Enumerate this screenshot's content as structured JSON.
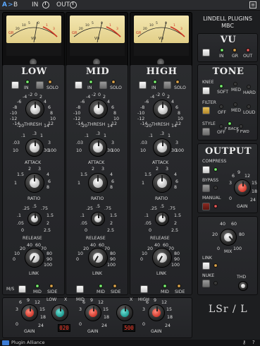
{
  "topbar": {
    "a": "A",
    "arrow": ">",
    "b": "B",
    "in": "IN",
    "out": "OUT",
    "help": "?"
  },
  "brand": {
    "line1": "LINDELL PLUGINS",
    "line2": "MBC"
  },
  "meters": {
    "vu": "VU",
    "gr": "GR",
    "scale": [
      "20",
      "10",
      "7",
      "5",
      "3",
      "2",
      "1",
      "0",
      "1",
      "2",
      "3"
    ]
  },
  "vu_panel": {
    "title": "VU",
    "in": "IN",
    "gr": "GR",
    "out": "OUT"
  },
  "bands": [
    {
      "title": "LOW",
      "in": "IN",
      "solo": "SOLO"
    },
    {
      "title": "MID",
      "in": "IN",
      "solo": "SOLO"
    },
    {
      "title": "HIGH",
      "in": "IN",
      "solo": "SOLO"
    }
  ],
  "labels": {
    "thresh": "THRESH",
    "attack": "ATTACK",
    "ratio": "RATIO",
    "release": "RELEASE",
    "link": "LINK"
  },
  "thresh_scale": [
    "-6",
    "-4",
    "-2",
    "0",
    "-8",
    "2",
    "-10",
    "4",
    "-12",
    "6",
    "-14",
    "8",
    "-16",
    "10",
    "-18",
    "12",
    "-20",
    "14"
  ],
  "attack_scale": [
    ".1",
    ".3",
    "1",
    "3",
    "10",
    "30",
    ".03",
    "100"
  ],
  "ratio_scale": [
    "2",
    "3",
    "1.5",
    "4",
    "6",
    "1",
    "8"
  ],
  "release_scale": [
    ".25",
    ".75",
    ".5",
    "1",
    ".1",
    "1.5",
    ".05",
    "2",
    "0",
    "2.5"
  ],
  "link_scale": [
    "40",
    "60",
    "20",
    "70",
    "80",
    "10",
    "90",
    "0",
    "100"
  ],
  "ms": {
    "ms": "M/S",
    "mid": "MID",
    "side": "SIDE"
  },
  "tone": {
    "title": "TONE",
    "knee": "KNEE",
    "soft": "SOFT",
    "med": "MED",
    "hard": "HARD",
    "filter": "FILTER",
    "off": "OFF",
    "filter_med": "MED",
    "loud": "LOUD",
    "style": "STYLE",
    "off2": "OFF",
    "fback": "F BACK",
    "ffwd": "F FWD"
  },
  "output": {
    "title": "OUTPUT",
    "compress": "COMPRESS",
    "bypass": "BYPASS",
    "manual": "MANUAL",
    "gain": "GAIN",
    "gain_scale": [
      "6",
      "9",
      "12",
      "3",
      "15",
      "0",
      "18",
      "24"
    ]
  },
  "mix": {
    "label": "MIX",
    "scale": [
      "40",
      "60",
      "20",
      "80",
      "0",
      "100"
    ]
  },
  "side": {
    "link": "LINK",
    "nuke": "NUKE",
    "thd": "THD"
  },
  "bottom": {
    "low": "LOW",
    "x1": "X",
    "mid": "MID",
    "x2": "X",
    "high": "HIGH",
    "gain": "GAIN",
    "d1": "020",
    "d2": "500",
    "gain_scale": [
      "6",
      "9",
      "12",
      "3",
      "15",
      "0",
      "18",
      "24"
    ]
  },
  "logo": "LSr / L",
  "footer": {
    "brand": "Plugin Alliance",
    "key": "key",
    "help": "?"
  }
}
